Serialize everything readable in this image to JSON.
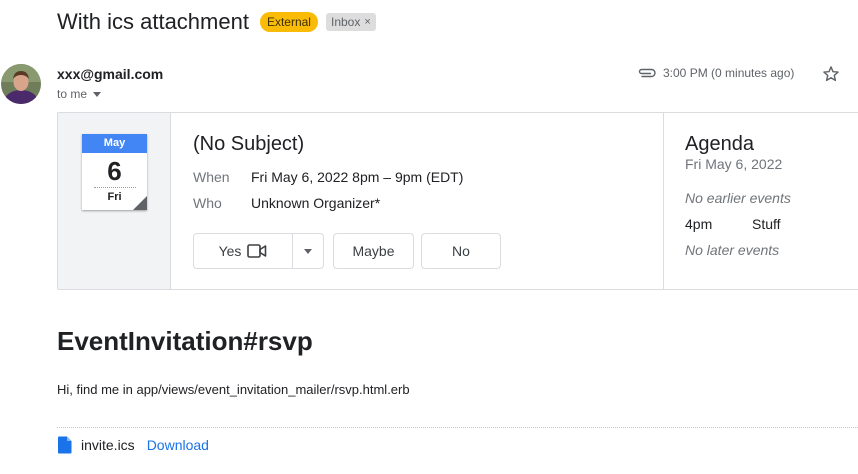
{
  "email": {
    "subject": "With ics attachment",
    "labels": {
      "external": "External",
      "inbox": "Inbox",
      "remove_label_glyph": "×"
    },
    "sender": "xxx@gmail.com",
    "recipient": "to me",
    "time": "3:00 PM (0 minutes ago)"
  },
  "invite": {
    "calendar_icon": {
      "month": "May",
      "day": "6",
      "weekday": "Fri"
    },
    "title": "(No Subject)",
    "when_label": "When",
    "when_value": "Fri May 6, 2022 8pm – 9pm (EDT)",
    "who_label": "Who",
    "who_value": "Unknown Organizer*",
    "rsvp": {
      "yes": "Yes",
      "maybe": "Maybe",
      "no": "No"
    }
  },
  "agenda": {
    "title": "Agenda",
    "date": "Fri May 6, 2022",
    "no_earlier": "No earlier events",
    "event_time": "4pm",
    "event_name": "Stuff",
    "no_later": "No later events"
  },
  "body": {
    "heading": "EventInvitation#rsvp",
    "text": "Hi, find me in app/views/event_invitation_mailer/rsvp.html.erb"
  },
  "attachment": {
    "filename": "invite.ics",
    "download_label": "Download",
    "icon": "file-icon"
  },
  "colors": {
    "external_badge": "#f9bb06",
    "calendar_header": "#4285f4",
    "link": "#1a73e8"
  }
}
